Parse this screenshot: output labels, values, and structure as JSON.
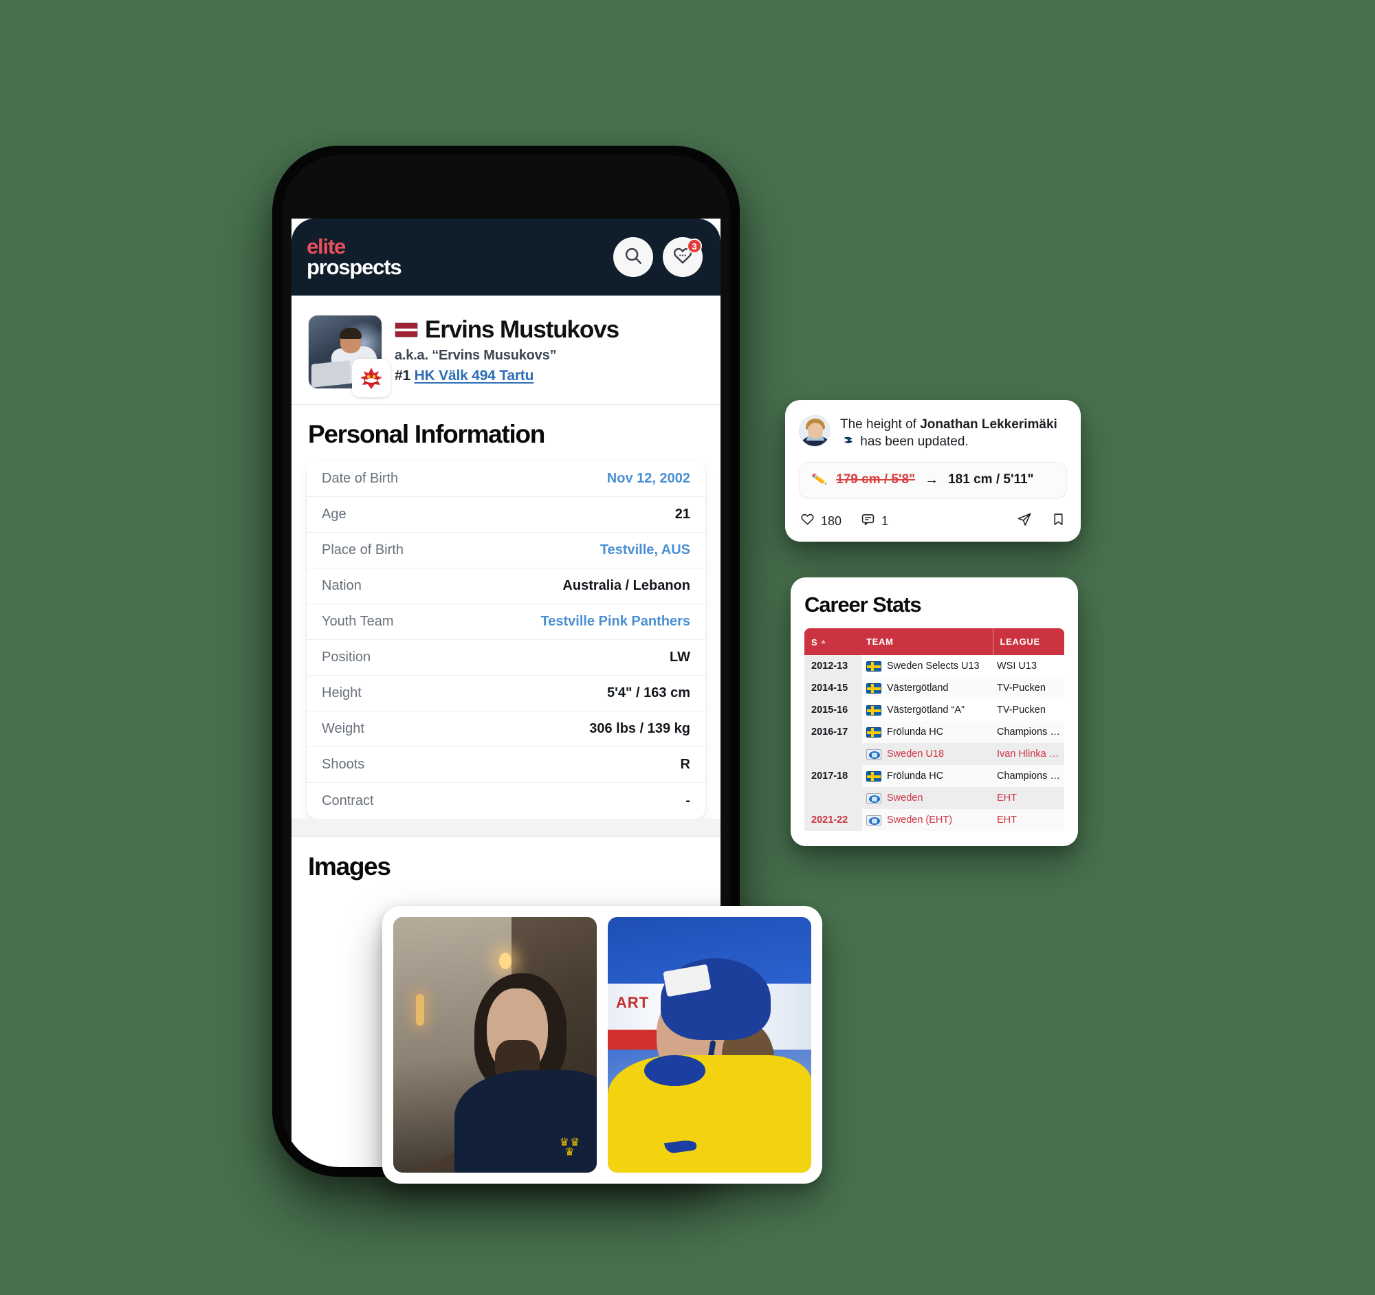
{
  "background_color": "#48714e",
  "app": {
    "brand": {
      "line1": "elite",
      "line2": "prospects",
      "accent_color": "#e8505c"
    },
    "header_bg": "#101d2b",
    "search_icon": "search-icon",
    "favorites_icon": "heart-chat-icon",
    "favorites_badge": "3"
  },
  "player": {
    "name": "Ervins Mustukovs",
    "nationality_flag": "Latvia",
    "aka": "a.k.a. “Ervins Musukovs”",
    "jersey_number": "#1",
    "team": "HK Välk 494 Tartu",
    "team_badge_icon": "hockey-canada-logo"
  },
  "personal_information": {
    "title": "Personal Information",
    "rows": [
      {
        "label": "Date of Birth",
        "value": "Nov 12, 2002",
        "link": true
      },
      {
        "label": "Age",
        "value": "21",
        "link": false
      },
      {
        "label": "Place of Birth",
        "value": "Testville, AUS",
        "link": true
      },
      {
        "label": "Nation",
        "value": "Australia / Lebanon",
        "link": false
      },
      {
        "label": "Youth Team",
        "value": "Testville Pink Panthers",
        "link": true
      },
      {
        "label": "Position",
        "value": "LW",
        "link": false
      },
      {
        "label": "Height",
        "value": "5'4\" / 163 cm",
        "link": false
      },
      {
        "label": "Weight",
        "value": "306 lbs / 139 kg",
        "link": false
      },
      {
        "label": "Shoots",
        "value": "R",
        "link": false
      },
      {
        "label": "Contract",
        "value": "-",
        "link": false
      }
    ]
  },
  "images_section": {
    "title": "Images",
    "photos": [
      {
        "alt": "Player portrait in stairwell wearing navy Sweden shirt"
      },
      {
        "alt": "Player in yellow Sweden jersey wearing blue CCM helmet at the rink"
      }
    ]
  },
  "notification": {
    "avatar_icon": "player-avatar",
    "text_before": "The height of ",
    "player": "Jonathan Lekkerimäki",
    "team_logo_icon": "vancouver-canucks-logo",
    "text_after": " has been updated.",
    "change": {
      "edit_icon": "pencil-icon",
      "old_value": "179 cm / 5'8\"",
      "arrow": "→",
      "new_value": "181 cm / 5'11\"",
      "old_value_color": "#d94141"
    },
    "actions": {
      "like_icon": "heart-icon",
      "like_count": "180",
      "comment_icon": "comment-icon",
      "comment_count": "1",
      "share_icon": "send-icon",
      "bookmark_icon": "bookmark-icon"
    }
  },
  "career_stats": {
    "title": "Career Stats",
    "header_color": "#cc3340",
    "columns": [
      {
        "key": "s",
        "label": "S",
        "sort_icon": "sort-asc-icon"
      },
      {
        "key": "team",
        "label": "TEAM"
      },
      {
        "key": "league",
        "label": "LEAGUE"
      }
    ],
    "rows": [
      {
        "s": "2012-13",
        "flag": "se",
        "team": "Sweden Selects U13",
        "league": "WSI U13",
        "highlight": false
      },
      {
        "s": "2014-15",
        "flag": "se",
        "team": "Västergötland",
        "league": "TV-Pucken",
        "highlight": false
      },
      {
        "s": "2015-16",
        "flag": "se",
        "team": "Västergötland “A”",
        "league": "TV-Pucken",
        "highlight": false
      },
      {
        "s": "2016-17",
        "flag": "se",
        "team": "Frölunda HC",
        "league": "Champions HL",
        "highlight": false
      },
      {
        "s": "",
        "flag": "world",
        "team": "Sweden U18",
        "league": "Ivan Hlinka Memorial",
        "highlight": true
      },
      {
        "s": "2017-18",
        "flag": "se",
        "team": "Frölunda HC",
        "league": "Champions HL",
        "highlight": false
      },
      {
        "s": "",
        "flag": "world",
        "team": "Sweden",
        "league": "EHT",
        "highlight": true
      },
      {
        "s": "2021-22",
        "flag": "world",
        "team": "Sweden (EHT)",
        "league": "EHT",
        "highlight": true
      }
    ]
  }
}
